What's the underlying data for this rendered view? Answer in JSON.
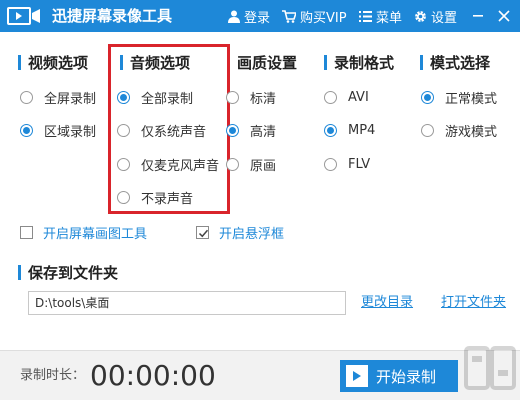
{
  "titlebar": {
    "app_title": "迅捷屏幕录像工具",
    "login_label": "登录",
    "vip_label": "购买VIP",
    "menu_label": "菜单",
    "settings_label": "设置"
  },
  "sections": {
    "video": {
      "title": "视频选项",
      "options": [
        {
          "label": "全屏录制",
          "selected": false
        },
        {
          "label": "区域录制",
          "selected": true
        }
      ]
    },
    "audio": {
      "title": "音频选项",
      "options": [
        {
          "label": "全部录制",
          "selected": true
        },
        {
          "label": "仅系统声音",
          "selected": false
        },
        {
          "label": "仅麦克风声音",
          "selected": false
        },
        {
          "label": "不录声音",
          "selected": false
        }
      ]
    },
    "quality": {
      "title": "画质设置",
      "options": [
        {
          "label": "标清",
          "selected": false
        },
        {
          "label": "高清",
          "selected": true
        },
        {
          "label": "原画",
          "selected": false
        }
      ]
    },
    "format": {
      "title": "录制格式",
      "options": [
        {
          "label": "AVI",
          "selected": false
        },
        {
          "label": "MP4",
          "selected": true
        },
        {
          "label": "FLV",
          "selected": false
        }
      ]
    },
    "mode": {
      "title": "模式选择",
      "options": [
        {
          "label": "正常模式",
          "selected": true
        },
        {
          "label": "游戏模式",
          "selected": false
        }
      ]
    }
  },
  "checkboxes": {
    "brush_tool": {
      "label": "开启屏幕画图工具",
      "checked": false
    },
    "float_frame": {
      "label": "开启悬浮框",
      "checked": true
    }
  },
  "save": {
    "title": "保存到文件夹",
    "path": "D:\\tools\\桌面",
    "change_dir_label": "更改目录",
    "open_folder_label": "打开文件夹"
  },
  "footer": {
    "duration_label": "录制时长：",
    "duration_value": "00:00:00",
    "start_label": "开始录制"
  },
  "colors": {
    "accent": "#1e88d8",
    "highlight": "#d9242b"
  }
}
